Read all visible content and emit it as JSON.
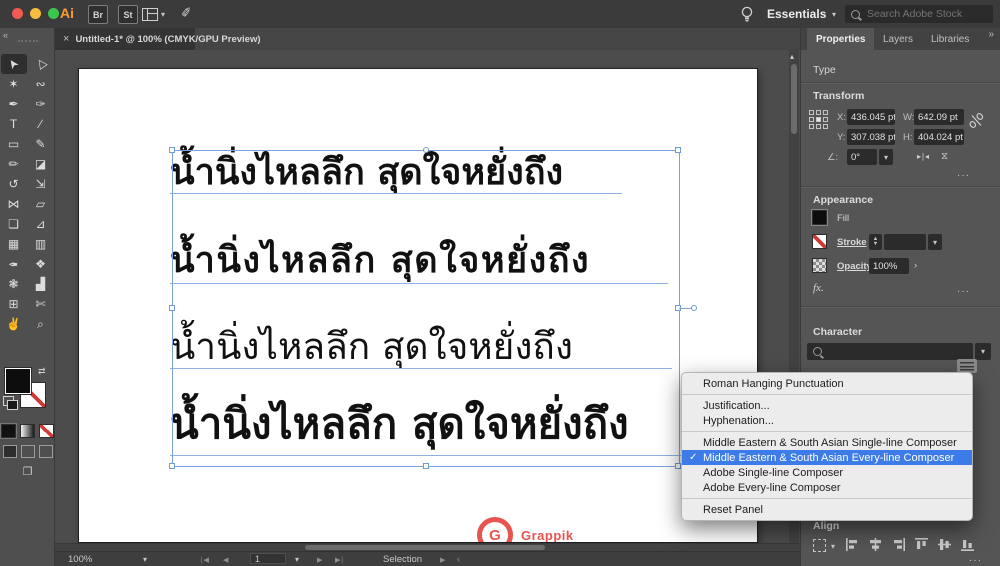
{
  "app": {
    "logo": "Ai",
    "bridge_label": "Br",
    "stock_label": "St",
    "workspace_name": "Essentials",
    "search_placeholder": "Search Adobe Stock"
  },
  "document_tab": {
    "title": "Untitled-1* @ 100% (CMYK/GPU Preview)"
  },
  "icons": {
    "close": "×",
    "collapse": "«",
    "chevron_down": "▾",
    "chevron_right": "›",
    "angle_left": "‹",
    "double_right": "»",
    "more": "···",
    "check": "✓",
    "swap": "⇄",
    "flip_h": "▸∣◂",
    "flip_v": "⧖",
    "play_r": "▶",
    "play_l": "◀",
    "to_start": "∣◀",
    "to_end": "▶∣",
    "scroll_up": "▴",
    "screen_mode": "❐"
  },
  "tools": [
    {
      "name": "selection-tool",
      "glyph": "➤",
      "cls": "cur",
      "active": true
    },
    {
      "name": "direct-selection-tool",
      "glyph": "▷",
      "cls": "cur"
    },
    {
      "name": "magic-wand-tool",
      "glyph": "✶"
    },
    {
      "name": "lasso-tool",
      "glyph": "∾"
    },
    {
      "name": "pen-tool",
      "glyph": "✒"
    },
    {
      "name": "curvature-tool",
      "glyph": "✑"
    },
    {
      "name": "type-tool",
      "glyph": "T"
    },
    {
      "name": "line-segment-tool",
      "glyph": "∕"
    },
    {
      "name": "rectangle-tool",
      "glyph": "▭"
    },
    {
      "name": "paintbrush-tool",
      "glyph": "✎"
    },
    {
      "name": "shaper-tool",
      "glyph": "✏"
    },
    {
      "name": "eraser-tool",
      "glyph": "◪"
    },
    {
      "name": "rotate-tool",
      "glyph": "↺"
    },
    {
      "name": "scale-tool",
      "glyph": "⇲"
    },
    {
      "name": "width-tool",
      "glyph": "⋈"
    },
    {
      "name": "free-transform-tool",
      "glyph": "▱"
    },
    {
      "name": "shape-builder-tool",
      "glyph": "❏"
    },
    {
      "name": "perspective-grid-tool",
      "glyph": "⊿"
    },
    {
      "name": "mesh-tool",
      "glyph": "▦"
    },
    {
      "name": "gradient-tool",
      "glyph": "▥"
    },
    {
      "name": "eyedropper-tool",
      "glyph": "✒",
      "cls": "rot180"
    },
    {
      "name": "blend-tool",
      "glyph": "❖"
    },
    {
      "name": "symbol-sprayer-tool",
      "glyph": "❃"
    },
    {
      "name": "column-graph-tool",
      "glyph": "▟"
    },
    {
      "name": "artboard-tool",
      "glyph": "⊞"
    },
    {
      "name": "slice-tool",
      "glyph": "✄"
    },
    {
      "name": "hand-tool",
      "glyph": "✌"
    },
    {
      "name": "zoom-tool",
      "glyph": "⌕"
    }
  ],
  "canvas": {
    "lines": [
      "น้ำนิ่งไหลลึก สุดใจหยั่งถึง",
      "น้ำนิ่งไหลลึก สุดใจหยั่งถึง",
      "น้ำนิ่งไหลลึก สุดใจหยั่งถึง",
      "น้ำนิ่งไหลลึก สุดใจหยั่งถึง"
    ],
    "watermark_letter": "G",
    "watermark_text": "Grappik"
  },
  "panel": {
    "tabs": [
      {
        "name": "properties",
        "label": "Properties",
        "active": true
      },
      {
        "name": "layers",
        "label": "Layers"
      },
      {
        "name": "libraries",
        "label": "Libraries"
      }
    ],
    "type_label": "Type",
    "transform": {
      "heading": "Transform",
      "x_label": "X:",
      "x_value": "436.045 pt",
      "y_label": "Y:",
      "y_value": "307.038 pt",
      "w_label": "W:",
      "w_value": "642.09 pt",
      "h_label": "H:",
      "h_value": "404.024 pt",
      "angle_label": "∠:",
      "angle_value": "0°"
    },
    "appearance": {
      "heading": "Appearance",
      "fill_label": "Fill",
      "stroke_label": "Stroke",
      "opacity_label": "Opacity",
      "opacity_value": "100%",
      "fx_label": "fx."
    },
    "character_heading": "Character",
    "align_label": "Align"
  },
  "context_menu": {
    "items": [
      {
        "name": "roman-hanging-punctuation",
        "label": "Roman Hanging Punctuation",
        "separator_after": true
      },
      {
        "name": "justification",
        "label": "Justification..."
      },
      {
        "name": "hyphenation",
        "label": "Hyphenation...",
        "separator_after": true
      },
      {
        "name": "mesa-single-line-composer",
        "label": "Middle Eastern & South Asian Single-line Composer"
      },
      {
        "name": "mesa-every-line-composer",
        "label": "Middle Eastern & South Asian Every-line Composer",
        "checked": true,
        "highlighted": true
      },
      {
        "name": "adobe-single-line-composer",
        "label": "Adobe Single-line Composer"
      },
      {
        "name": "adobe-every-line-composer",
        "label": "Adobe Every-line Composer",
        "separator_after": true
      },
      {
        "name": "reset-panel",
        "label": "Reset Panel"
      }
    ]
  },
  "status_bar": {
    "zoom_level": "100%",
    "artboard_number": "1",
    "mode_label": "Selection"
  }
}
